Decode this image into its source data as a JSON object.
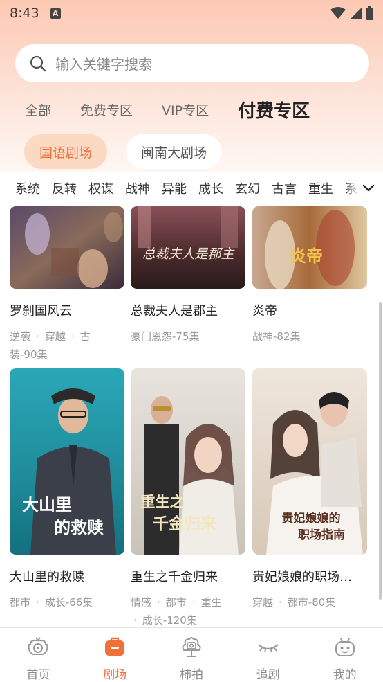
{
  "status_bar": {
    "time": "8:43",
    "notification_icon": "A"
  },
  "search": {
    "placeholder": "输入关键字搜索"
  },
  "zone_tabs": [
    {
      "label": "全部"
    },
    {
      "label": "免费专区"
    },
    {
      "label": "VIP专区"
    },
    {
      "label": "付费专区",
      "selected": true
    }
  ],
  "region_pills": [
    {
      "label": "国语剧场",
      "selected": true
    },
    {
      "label": "闽南大剧场"
    }
  ],
  "genres": [
    "系统",
    "反转",
    "权谋",
    "战神",
    "异能",
    "成长",
    "玄幻",
    "古言",
    "重生",
    "系"
  ],
  "cards": [
    {
      "title": "罗刹国风云",
      "tags_line1": [
        "逆袭",
        "穿越",
        "古"
      ],
      "tags_line2": "装-90集"
    },
    {
      "title": "总裁夫人是郡主",
      "poster_text": "总裁夫人是郡主",
      "tags_line1": [
        "豪门恩怨-75集"
      ]
    },
    {
      "title": "炎帝",
      "poster_text": "炎帝",
      "tags_line1": [
        "战神-82集"
      ]
    },
    {
      "title": "大山里的救赎",
      "poster_text_line1": "大山里",
      "poster_text_line2": "的救赎",
      "tags_line1": [
        "都市",
        "成长-66集"
      ]
    },
    {
      "title": "重生之千金归来",
      "poster_text_line1": "重生之",
      "poster_text_line2": "千金归来",
      "tags_line1": [
        "情感",
        "都市",
        "重生"
      ],
      "tags_line2": "成长-120集"
    },
    {
      "title": "贵妃娘娘的职场…",
      "poster_text_line1": "贵妃娘娘的",
      "poster_text_line2": "职场指南",
      "tags_line1": [
        "穿越",
        "都市-80集"
      ]
    }
  ],
  "bottom_nav": [
    {
      "label": "首页",
      "icon": "play-cloud-icon"
    },
    {
      "label": "剧场",
      "icon": "briefcase-icon",
      "active": true
    },
    {
      "label": "柿拍",
      "icon": "camera-cloud-icon"
    },
    {
      "label": "追剧",
      "icon": "closed-eye-icon"
    },
    {
      "label": "我的",
      "icon": "robot-face-icon"
    }
  ],
  "colors": {
    "accent": "#f0703a",
    "pill_active_bg": "#fbd9c3",
    "header_gradient_top": "#fdc9b4"
  }
}
